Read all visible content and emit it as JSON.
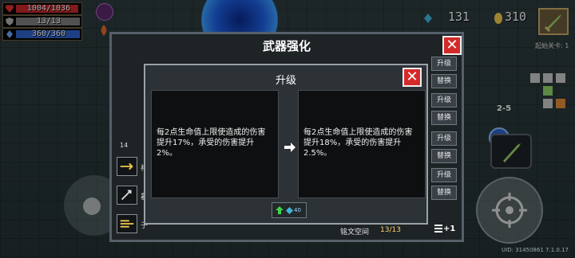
{
  "hud": {
    "hp": "1004/1036",
    "hp_fraction": 0.969,
    "armor": "13/13",
    "armor_fraction": 1.0,
    "energy": "360/360",
    "energy_fraction": 1.0,
    "gems": "131",
    "coins": "310",
    "stage_label": "起始关卡: 1",
    "floor": "2-5",
    "skill_count": "2",
    "version": "UID: 31450861 7.1.0.17"
  },
  "dialog": {
    "title": "武器强化",
    "close_icon": "close-icon",
    "side_buttons": [
      "升级",
      "替换",
      "升级",
      "替换",
      "升级",
      "替换",
      "升级",
      "替换"
    ],
    "slot_labels": [
      "神",
      "暴",
      "子"
    ],
    "level_text": "14",
    "rune_space_label": "铭文空间",
    "rune_count": "13/13",
    "add_button_label": "+1"
  },
  "upgrade_popup": {
    "title": "升级",
    "current_text": "每2点生命值上限使造成的伤害提升17%，承受的伤害提升2%。",
    "next_text": "每2点生命值上限使造成的伤害提升18%，承受的伤害提升2.5%。",
    "cost": "40",
    "colors": {
      "accent_red": "#d42a2a",
      "confirm_green": "#3fd34a"
    }
  }
}
